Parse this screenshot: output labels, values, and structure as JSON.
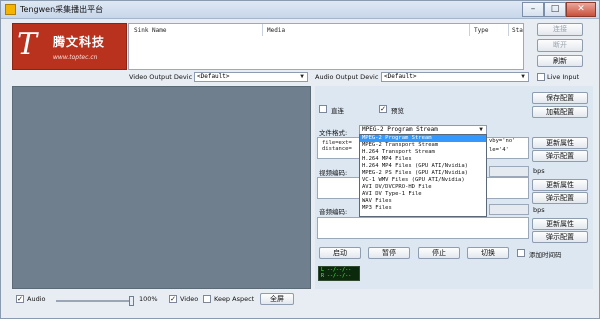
{
  "window": {
    "title": "Tengwen采集播出平台"
  },
  "logo": {
    "name": "腾文科技",
    "url": "www.toptec.cn"
  },
  "sink_list": {
    "columns": [
      "Sink Name",
      "Media",
      "Type",
      "Sta"
    ]
  },
  "right_buttons": {
    "connect": "连接",
    "disconnect": "断开",
    "refresh": "刷新"
  },
  "live_input": {
    "label": "Live Input",
    "checked": false
  },
  "video_output": {
    "label": "Video Output Devic",
    "value": "<Default>"
  },
  "audio_output": {
    "label": "Audio Output Devic",
    "value": "<Default>"
  },
  "panel": {
    "direct": {
      "label": "直连",
      "checked": false
    },
    "preview": {
      "label": "预览",
      "checked": true
    },
    "save_config": "保存配置",
    "load_config": "加载配置",
    "file_format_label": "文件格式:",
    "file_format_value": "MPEG-2 Program Stream",
    "file_options_line1": "file=ext=",
    "file_options_line2": "distance=",
    "file_options_right1": "vby='no'",
    "file_options_right2": "le='4'",
    "more_props_1": "更新属性",
    "show_config_1": "弹示配置",
    "video_codec_label": "视频编码:",
    "bps_1": "bps",
    "more_props_2": "更新属性",
    "show_config_2": "弹示配置",
    "audio_codec_label": "音频编码:",
    "bps_2": "bps",
    "more_props_3": "更新属性",
    "show_config_3": "弹示配置",
    "start": "启动",
    "pause": "暂停",
    "stop": "停止",
    "switch": "切换",
    "add_timecode": {
      "label": "添加时间码",
      "checked": false
    },
    "meter_line1": "L --/--/--",
    "meter_line2": "R --/--/--"
  },
  "format_options": [
    "MPEG-2 Program Stream",
    "MPEG-2 Transport Stream",
    "H.264 Transport Stream",
    "H.264 MP4 Files",
    "H.264 MP4 Files (GPU ATI/Nvidia)",
    "MPEG-2 PS Files (GPU ATI/Nvidia)",
    "VC-1 WMV Files (GPU ATI/Nvidia)",
    "AVI DV/DVCPRO-HD File",
    "AVI DV Type-1 File",
    "WAV Files",
    "MP3 Files"
  ],
  "format_selected_index": 0,
  "bottom_bar": {
    "audio": {
      "label": "Audio",
      "checked": true
    },
    "volume_percent": "100%",
    "volume_level": 1.0,
    "video": {
      "label": "Video",
      "checked": true
    },
    "keep_aspect": {
      "label": "Keep Aspect",
      "checked": false
    },
    "fullscreen": "全屏"
  }
}
